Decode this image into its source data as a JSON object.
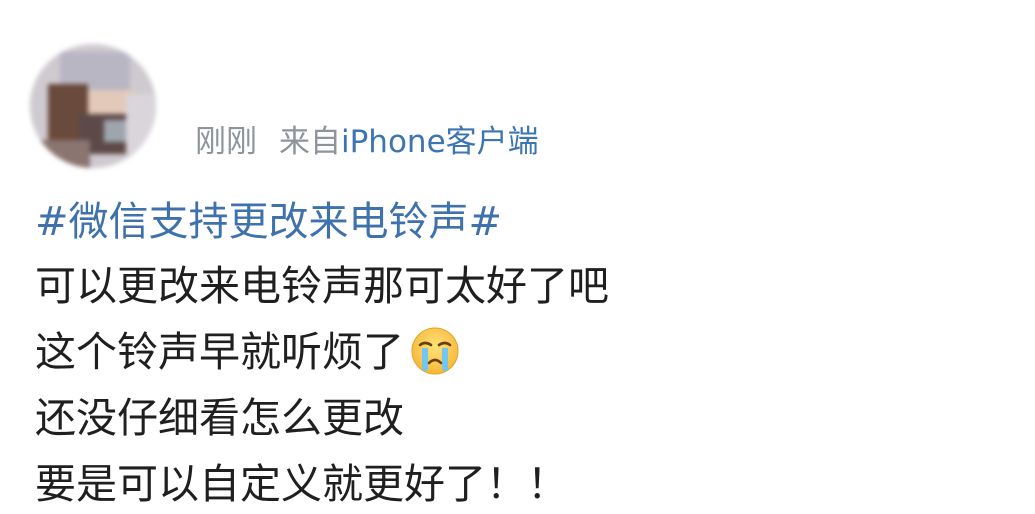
{
  "post": {
    "username": "",
    "meta": {
      "time": "刚刚",
      "source_prefix": "来自",
      "client": "iPhone客户端"
    },
    "hashtag": "#微信支持更改来电铃声#",
    "lines": [
      "可以更改来电铃声那可太好了吧",
      "这个铃声早就听烦了",
      "还没仔细看怎么更改",
      "要是可以自定义就更好了！！"
    ],
    "emoji": "crying-face-emoji",
    "colors": {
      "hashtag": "#3f72ad",
      "client_link": "#3d75b3",
      "meta": "#8e949c",
      "text": "#1f1f1f"
    }
  }
}
